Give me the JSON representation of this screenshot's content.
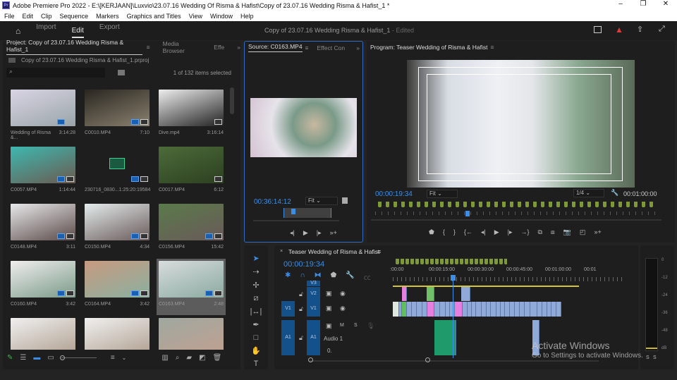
{
  "titlebar": {
    "app_icon": "Pr",
    "title": "Adobe Premiere Pro 2022 - E:\\[KERJAAN]\\Luxvio\\23.07.16 Wedding Of Risma & Hafist\\Copy of 23.07.16 Wedding Risma & Hafist_1 *",
    "minimize": "–",
    "maximize": "❐",
    "close": "✕"
  },
  "menu": [
    "File",
    "Edit",
    "Clip",
    "Sequence",
    "Markers",
    "Graphics and Titles",
    "View",
    "Window",
    "Help"
  ],
  "header": {
    "workspaces": [
      "Import",
      "Edit",
      "Export"
    ],
    "active": "Edit",
    "project_title": "Copy of 23.07.16 Wedding Risma & Hafist_1",
    "edited": "- Edited"
  },
  "project": {
    "tabs": [
      "Project: Copy of 23.07.16 Wedding Risma & Hafist_1",
      "Media Browser",
      "Effe"
    ],
    "file": "Copy of 23.07.16 Wedding Risma & Hafist_1.prproj",
    "search_placeholder": "",
    "selection": "1 of 132 items selected",
    "items": [
      {
        "name": "Wedding of Risma &...",
        "dur": "3:14:28",
        "c1": "#d9d4e4",
        "c2": "#9aa5a8"
      },
      {
        "name": "C0010.MP4",
        "dur": "7:10",
        "c1": "#2a2620",
        "c2": "#8a8270"
      },
      {
        "name": "Dive.mp4",
        "dur": "3:16:14",
        "c1": "#eeeeee",
        "c2": "#222"
      },
      {
        "name": "C0057.MP4",
        "dur": "1:14:44",
        "c1": "#3db8b0",
        "c2": "#6b5a50"
      },
      {
        "name": "230716_0830...",
        "dur": "1:25:20:19584",
        "c1": "#1e1e1e",
        "c2": "#1e1e1e"
      },
      {
        "name": "C0017.MP4",
        "dur": "6:12",
        "c1": "#4d6b3a",
        "c2": "#2c4020"
      },
      {
        "name": "C0148.MP4",
        "dur": "3:11",
        "c1": "#e8e8ea",
        "c2": "#5a4a48"
      },
      {
        "name": "C0150.MP4",
        "dur": "4:34",
        "c1": "#e4ecec",
        "c2": "#6a5a5a"
      },
      {
        "name": "C0156.MP4",
        "dur": "15:42",
        "c1": "#5a7a4a",
        "c2": "#6a5a5a"
      },
      {
        "name": "C0160.MP4",
        "dur": "3:42",
        "c1": "#f0eeee",
        "c2": "#7a9a88"
      },
      {
        "name": "C0164.MP4",
        "dur": "3:42",
        "c1": "#c89a80",
        "c2": "#8ab0a0"
      },
      {
        "name": "C0163.MP4",
        "dur": "2:48",
        "c1": "#d8dcdc",
        "c2": "#8aaaa0"
      },
      {
        "name": "",
        "dur": "",
        "c1": "#f0f0f0",
        "c2": "#b0a090"
      },
      {
        "name": "",
        "dur": "",
        "c1": "#f0f0f0",
        "c2": "#b0a090"
      },
      {
        "name": "",
        "dur": "",
        "c1": "#a0a8a0",
        "c2": "#c0a090"
      }
    ]
  },
  "source": {
    "tabs": [
      "Source: C0163.MP4",
      "Effect Con"
    ],
    "timecode": "00:36:14:12",
    "zoom": "Fit"
  },
  "program": {
    "tab": "Program: Teaser Wedding of Risma & Hafist",
    "timecode": "00:00:19:34",
    "zoom": "Fit",
    "resolution": "1/4",
    "duration": "00:01:00:00"
  },
  "timeline": {
    "tab": "Teaser Wedding of Risma & Hafist",
    "timecode": "00:00:19:34",
    "ruler": [
      ":00:00",
      "00:00:15:00",
      "00:00:30:00",
      "00:00:45:00",
      "00:01:00:00",
      "00:01"
    ],
    "tracks": {
      "v3": "V3",
      "v2": "V2",
      "v1": "V1",
      "a1": "A1",
      "src_v1": "V1",
      "src_a1": "A1",
      "audio_name": "Audio 1",
      "m": "M",
      "s": "S",
      "vol": "0."
    }
  },
  "meters": {
    "scale": [
      "0",
      "-12",
      "-24",
      "-36",
      "-48",
      "dB"
    ],
    "solo": [
      "S",
      "S"
    ]
  },
  "watermark": {
    "title": "Activate Windows",
    "sub": "Go to Settings to activate Windows."
  }
}
